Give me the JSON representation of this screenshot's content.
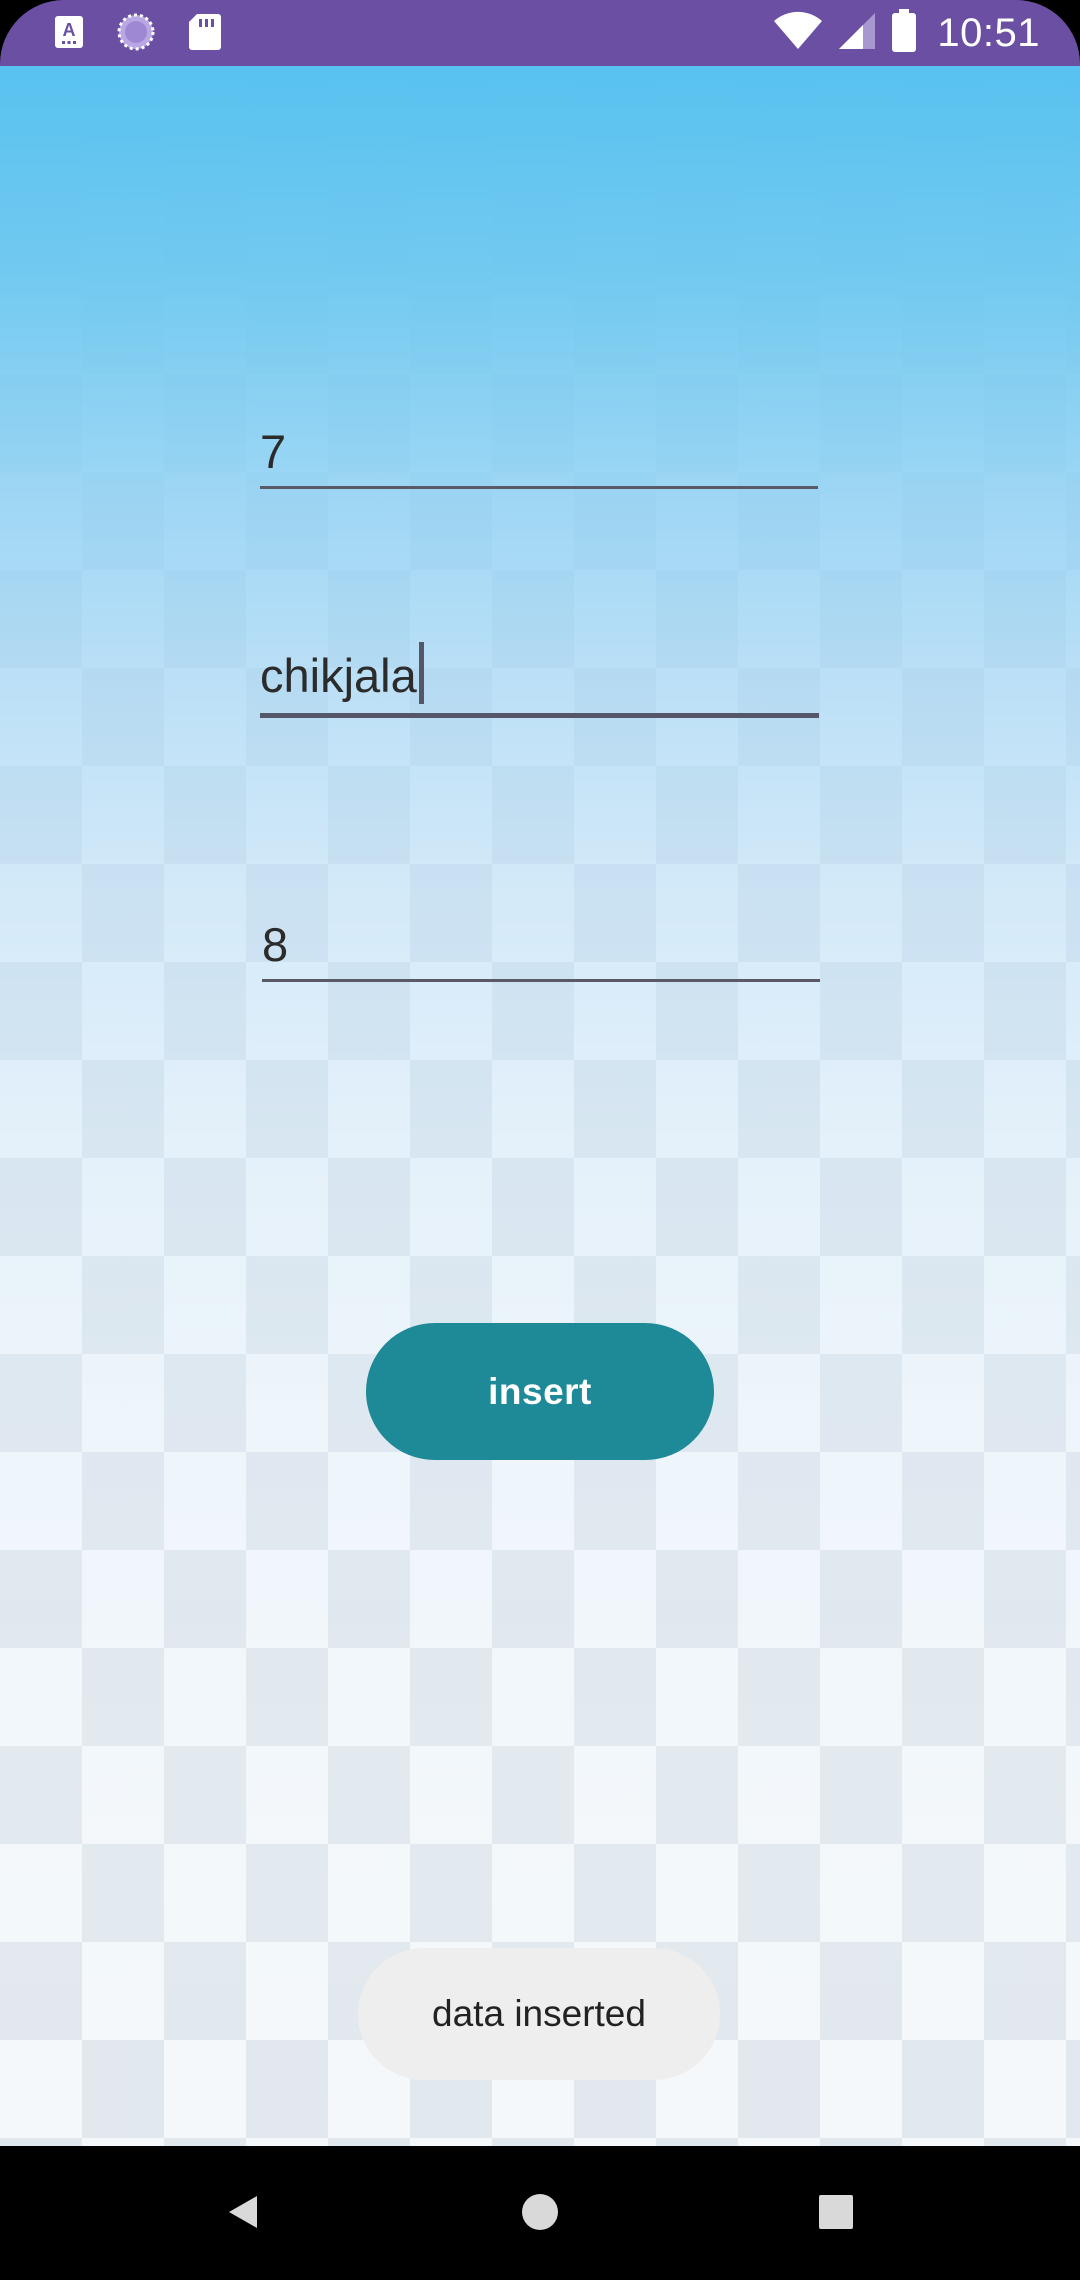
{
  "status_bar": {
    "time": "10:51",
    "left_icons": [
      "keyboard-a-icon",
      "sync-circle-icon",
      "sd-card-icon"
    ],
    "right_icons": [
      "wifi-icon",
      "cell-signal-icon",
      "battery-icon"
    ],
    "background_color": "#6a4fa3"
  },
  "form": {
    "field_1_value": "7",
    "field_2_value": "chikjala",
    "field_3_value": "8",
    "insert_label": "insert",
    "accent_color": "#1e8a98"
  },
  "toast": {
    "message": "data inserted"
  },
  "nav_bar": {
    "buttons": [
      "back-icon",
      "home-icon",
      "recents-icon"
    ]
  }
}
